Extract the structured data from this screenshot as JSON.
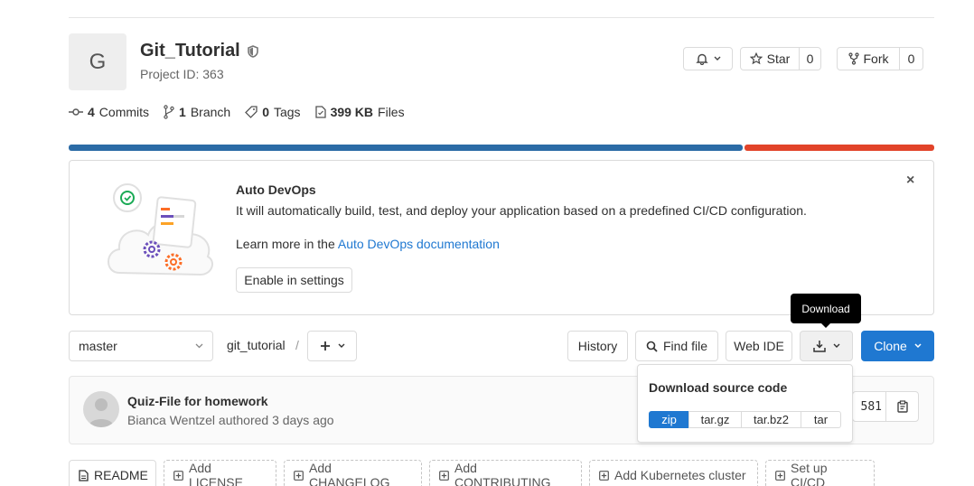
{
  "project": {
    "avatar_letter": "G",
    "name": "Git_Tutorial",
    "id_text": "Project ID: 363"
  },
  "actions": {
    "star_label": "Star",
    "star_count": "0",
    "fork_label": "Fork",
    "fork_count": "0"
  },
  "stats": {
    "commits_count": "4",
    "commits_label": "Commits",
    "branch_count": "1",
    "branch_label": "Branch",
    "tags_count": "0",
    "tags_label": "Tags",
    "files_size": "399 KB",
    "files_label": "Files"
  },
  "language_bar": {
    "colors": [
      "#2b6ba6",
      "#e24329"
    ],
    "fractions": [
      0.78,
      0.22
    ]
  },
  "devops": {
    "title": "Auto DevOps",
    "description": "It will automatically build, test, and deploy your application based on a predefined CI/CD configuration.",
    "learn_prefix": "Learn more in the ",
    "learn_link": "Auto DevOps documentation",
    "enable_button": "Enable in settings",
    "close_glyph": "×"
  },
  "tooltip": {
    "text": "Download"
  },
  "repo_toolbar": {
    "branch": "master",
    "path": "git_tutorial",
    "slash": "/",
    "history": "History",
    "find_file": "Find file",
    "web_ide": "Web IDE",
    "clone": "Clone"
  },
  "commit": {
    "title": "Quiz-File for homework",
    "meta": "Bianca Wentzel authored 3 days ago",
    "sha_fragment": "581"
  },
  "download_dropdown": {
    "title": "Download source code",
    "options": [
      "zip",
      "tar.gz",
      "tar.bz2",
      "tar"
    ],
    "selected": "zip"
  },
  "quick_actions": [
    "README",
    "Add LICENSE",
    "Add CHANGELOG",
    "Add CONTRIBUTING",
    "Add Kubernetes cluster",
    "Set up CI/CD"
  ],
  "colors": {
    "accent": "#1f78d1",
    "link": "#1f78d1"
  }
}
